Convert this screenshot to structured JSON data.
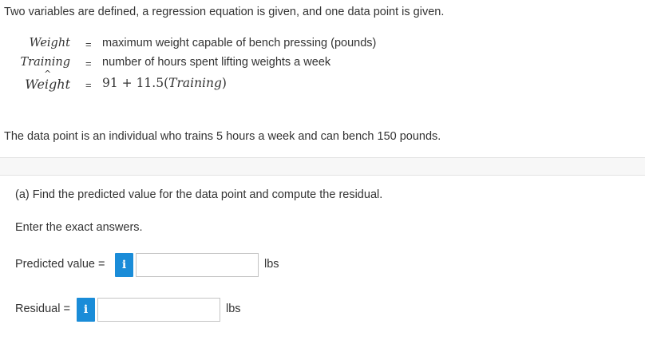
{
  "intro": "Two variables are defined, a regression equation is given, and one data point is given.",
  "definitions": [
    {
      "term": "Weight",
      "eq": "=",
      "text": "maximum weight capable of bench pressing (pounds)"
    },
    {
      "term": "Training",
      "eq": "=",
      "text": "number of hours spent lifting weights a week"
    },
    {
      "term": "Weight",
      "hat": "^",
      "eq": "=",
      "text_prefix": "91 + 11.5(",
      "text_var": "Training",
      "text_suffix": ")"
    }
  ],
  "datapoint": "The data point is an individual who trains 5 hours a week and can bench 150 pounds.",
  "part_a": {
    "question": "(a) Find the predicted value for the data point and compute the residual.",
    "instruction": "Enter the exact answers.",
    "fields": [
      {
        "label": "Predicted value =",
        "info_icon": "i",
        "value": "",
        "unit": "lbs"
      },
      {
        "label": "Residual =",
        "info_icon": "i",
        "value": "",
        "unit": "lbs"
      }
    ]
  },
  "colors": {
    "info_button": "#1a8cd8",
    "text": "#333333",
    "band": "#f7f7f7"
  }
}
